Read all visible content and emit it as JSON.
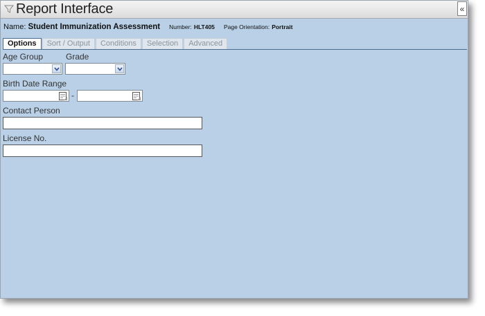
{
  "window": {
    "title": "Report Interface",
    "collapse_glyph": "«"
  },
  "info": {
    "name_label": "Name:",
    "name_value": "Student Immunization Assessment",
    "number_label": "Number:",
    "number_value": "HLT405",
    "orientation_label": "Page Orientation:",
    "orientation_value": "Portrait"
  },
  "tabs": [
    {
      "label": "Options",
      "active": true
    },
    {
      "label": "Sort / Output",
      "active": false
    },
    {
      "label": "Conditions",
      "active": false
    },
    {
      "label": "Selection",
      "active": false
    },
    {
      "label": "Advanced",
      "active": false
    }
  ],
  "form": {
    "age_group": {
      "label": "Age Group",
      "value": ""
    },
    "grade": {
      "label": "Grade",
      "value": ""
    },
    "birth_date_range": {
      "label": "Birth Date Range",
      "separator": "-",
      "from": "",
      "to": ""
    },
    "contact_person": {
      "label": "Contact Person",
      "value": ""
    },
    "license_no": {
      "label": "License No.",
      "value": ""
    }
  },
  "icons": {
    "title": "funnel-icon",
    "calendar": "calendar-icon",
    "dropdown": "chevron-down-icon"
  }
}
